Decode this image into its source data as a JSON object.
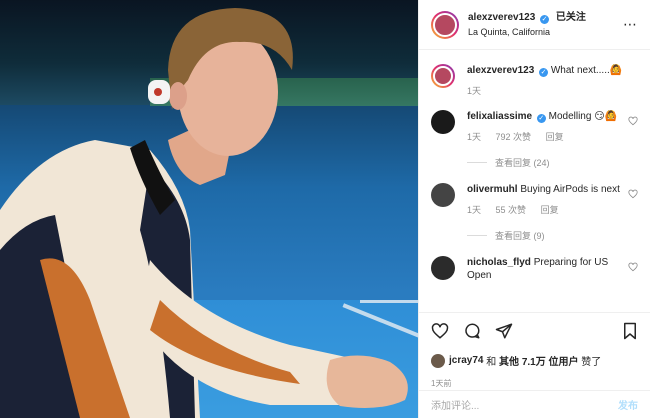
{
  "header": {
    "username": "alexzverev123",
    "follow_label": "已关注",
    "location": "La Quinta, California",
    "more_icon": "more-icon"
  },
  "caption": {
    "username": "alexzverev123",
    "text": "What next.....🙆",
    "time": "1天"
  },
  "comments": [
    {
      "username": "felixaliassime",
      "text": "Modelling 😏🙆",
      "time": "1天",
      "likes": "792 次赞",
      "reply": "回复",
      "view_replies": "查看回复 (24)"
    },
    {
      "username": "olivermuhl",
      "text": "Buying AirPods is next",
      "time": "1天",
      "likes": "55 次赞",
      "reply": "回复",
      "view_replies": "查看回复 (9)"
    },
    {
      "username": "nicholas_flyd",
      "text": "Preparing for US Open"
    }
  ],
  "likes": {
    "user": "jcray74",
    "and": "和",
    "others": "其他",
    "count": "7.1万",
    "unit": "位用户",
    "suffix": "赞了"
  },
  "timestamp": "1天前",
  "comment_box": {
    "placeholder": "添加评论...",
    "post_label": "发布"
  },
  "colors": {
    "verified": "#3897f0",
    "post_button": "#b2dffc",
    "muted": "#8e8e8e"
  }
}
